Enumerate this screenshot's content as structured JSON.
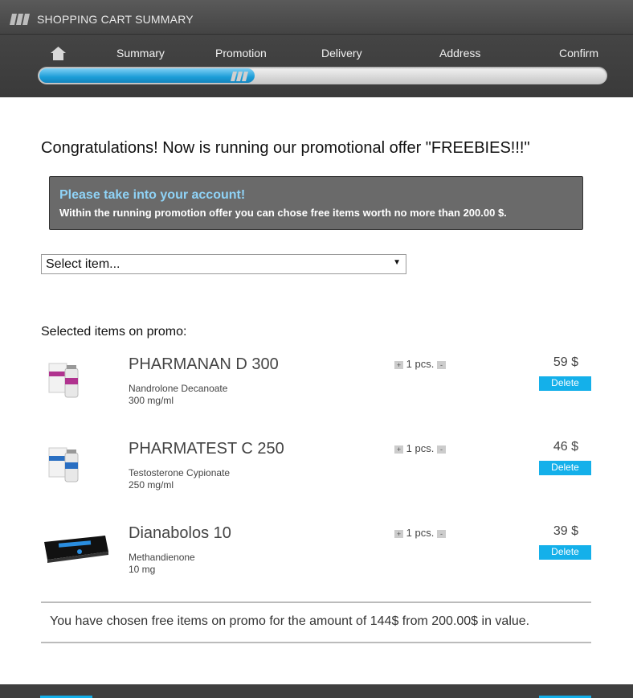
{
  "header": {
    "title": "SHOPPING CART SUMMARY",
    "steps": [
      "Summary",
      "Promotion",
      "Delivery",
      "Address",
      "Confirm"
    ],
    "progress": 0.38
  },
  "main": {
    "headline": "Congratulations! Now is running our promotional offer \"FREEBIES!!!\"",
    "notice": {
      "title": "Please take into your account!",
      "body": "Within the running promotion offer you can chose free items worth no more than 200.00 $."
    },
    "select": {
      "value": "Select item..."
    },
    "selected_label": "Selected items on promo:",
    "items": [
      {
        "name": "PHARMANAN D 300",
        "substance": "Nandrolone Decanoate",
        "dose": "300 mg/ml",
        "qty": "1 pcs.",
        "price": "59 $",
        "delete_label": "Delete",
        "plus": "+",
        "minus": "-"
      },
      {
        "name": "PHARMATEST C 250",
        "substance": "Testosterone Cypionate",
        "dose": "250 mg/ml",
        "qty": "1 pcs.",
        "price": "46 $",
        "delete_label": "Delete",
        "plus": "+",
        "minus": "-"
      },
      {
        "name": "Dianabolos 10",
        "substance": "Methandienone",
        "dose": "10 mg",
        "qty": "1 pcs.",
        "price": "39 $",
        "delete_label": "Delete",
        "plus": "+",
        "minus": "-"
      }
    ],
    "summary": "You have chosen free items on promo for the amount of 144$ from 200.00$ in value."
  },
  "colors": {
    "accent": "#14b0ea",
    "notice_bg": "#6a6a6a",
    "notice_title": "#8fd3f7",
    "header_bg": "#3f3f3f"
  },
  "icons": [
    "logo-icon",
    "home-icon",
    "progress-logo-icon"
  ]
}
